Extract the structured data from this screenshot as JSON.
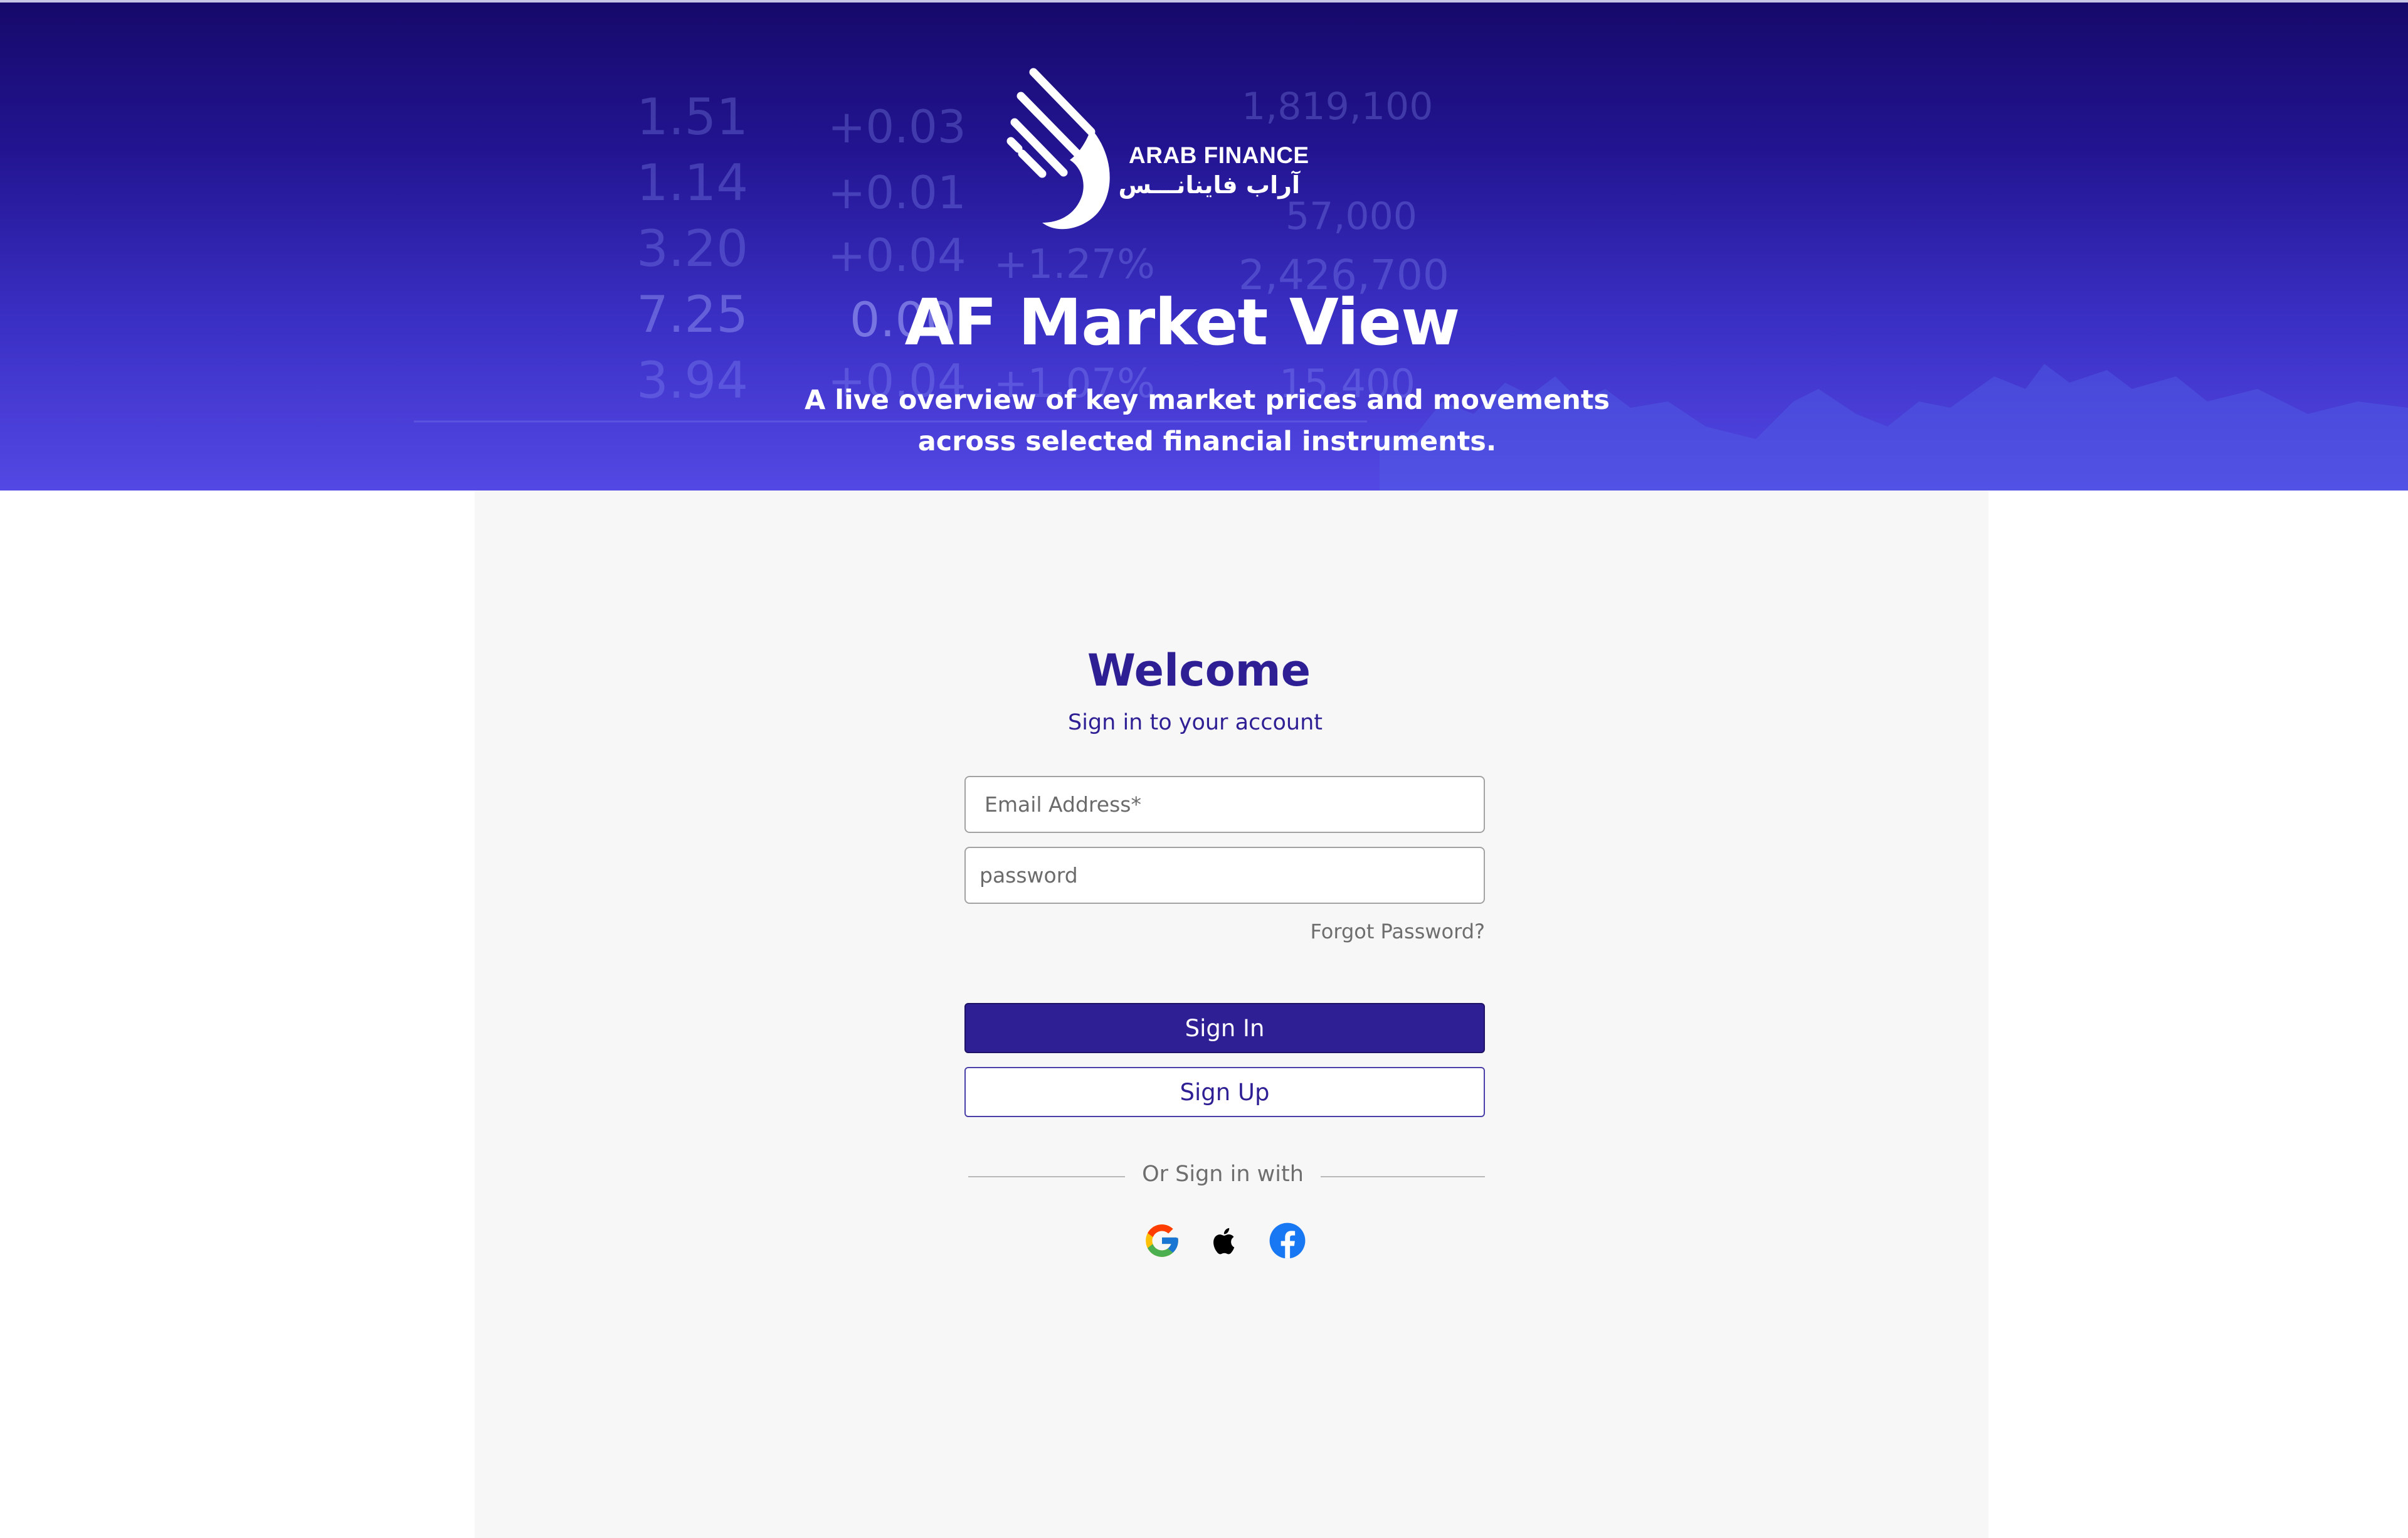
{
  "hero": {
    "brand_en": "ARAB FINANCE",
    "brand_ar": "آراب فاينانـــس",
    "title": "AF Market View",
    "subtitle": "A live overview of key market prices and movements across selected financial instruments.",
    "ticker_background": [
      "1.51",
      "1.14",
      "3.20",
      "7.25",
      "3.94",
      "+0.03",
      "+0.01",
      "+0.04",
      "0.00",
      "+0.04",
      "+1.27%",
      "+1.07%",
      "1,819,100",
      "57,000",
      "2,426,700",
      "15,400"
    ]
  },
  "login": {
    "welcome": "Welcome",
    "subtitle": "Sign in to your account",
    "email_placeholder": "Email Address*",
    "password_placeholder": "password",
    "forgot_password": "Forgot Password?",
    "sign_in": "Sign In",
    "sign_up": "Sign Up",
    "divider_text": "Or Sign in with",
    "social": [
      "google-icon",
      "apple-icon",
      "facebook-icon"
    ]
  },
  "colors": {
    "brand_primary": "#2e1f94",
    "hero_top": "#16096a",
    "hero_bottom": "#5448e4",
    "panel_bg": "#f7f7f7"
  }
}
